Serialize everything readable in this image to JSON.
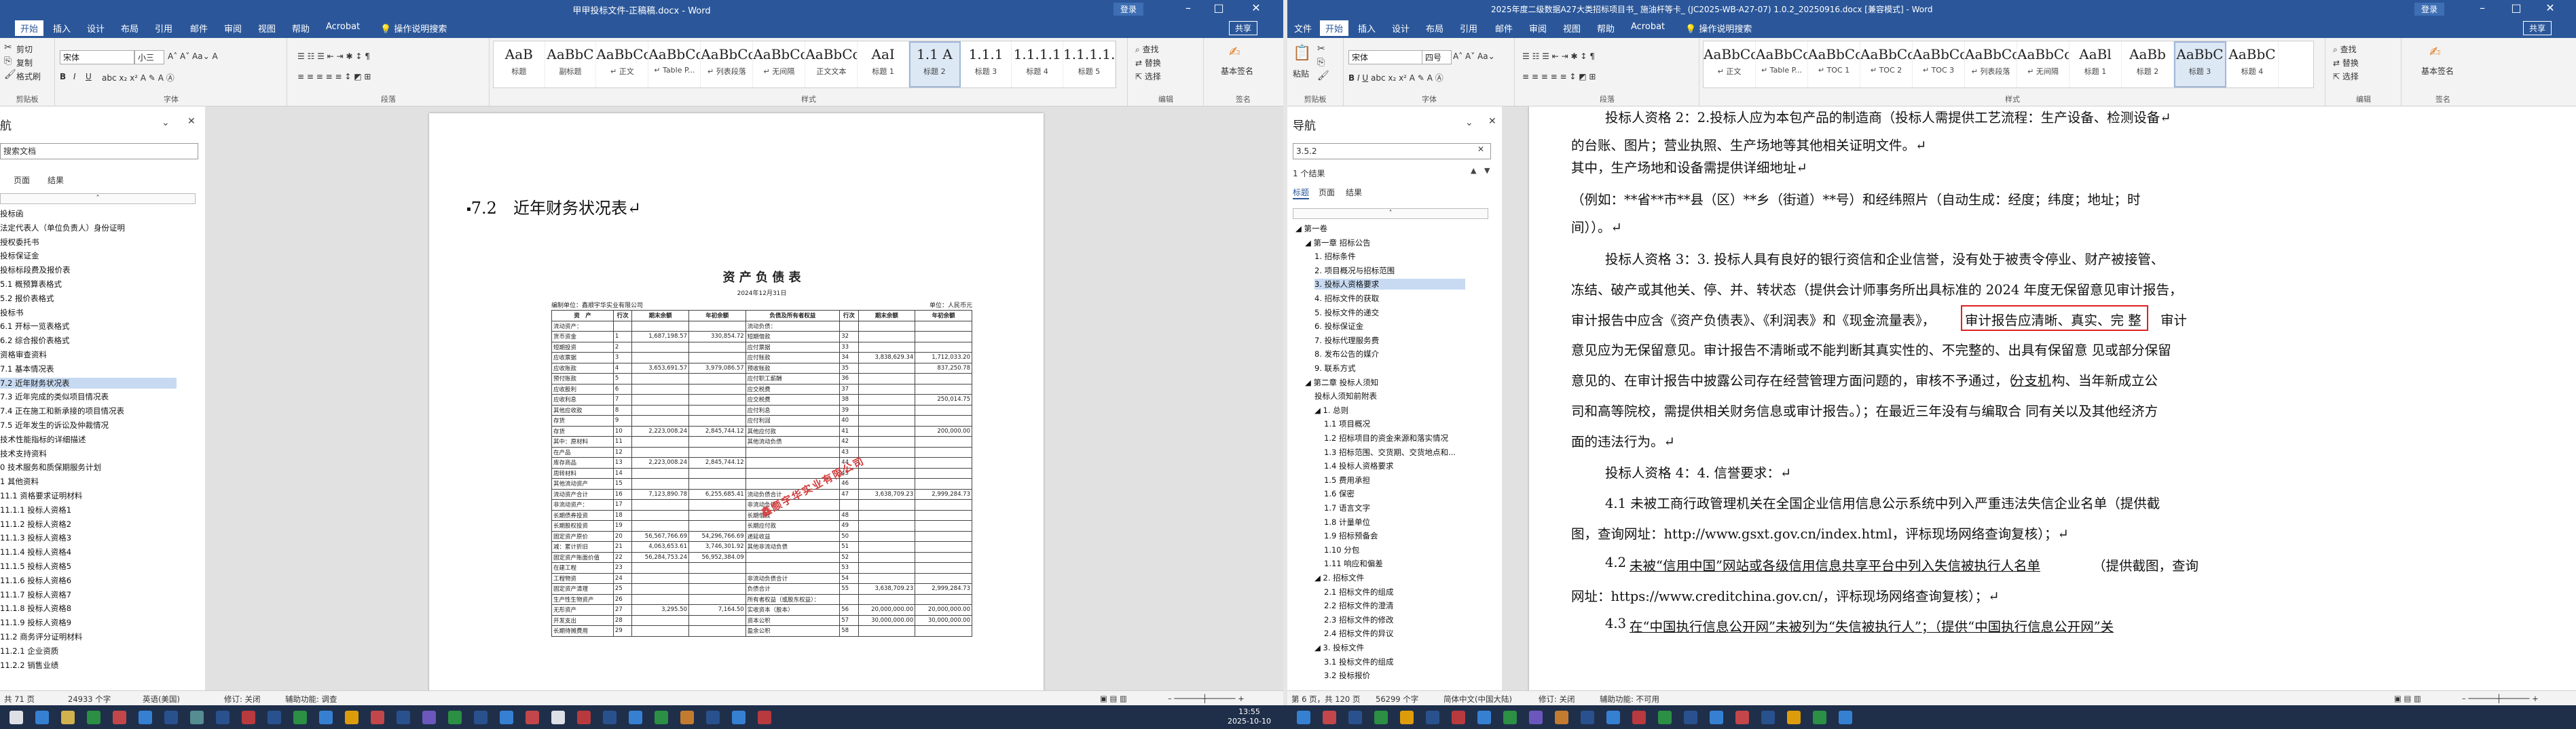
{
  "left_window": {
    "title": "甲甲投标文件-正稿稿.docx - Word",
    "login": "登录",
    "share": "共享",
    "tabs": [
      "开始",
      "插入",
      "设计",
      "布局",
      "引用",
      "邮件",
      "审阅",
      "视图",
      "帮助",
      "Acrobat",
      "操作说明搜索"
    ],
    "active_tab": "开始",
    "clipboard": {
      "paste": "粘贴",
      "cut": "剪切",
      "copy": "复制",
      "format_painter": "格式刷"
    },
    "font": {
      "name": "宋体",
      "size": "小三"
    },
    "group_labels": {
      "clipboard": "剪贴板",
      "font": "字体",
      "paragraph": "段落",
      "styles": "样式",
      "editing": "编辑",
      "sign": "签名"
    },
    "styles": [
      {
        "preview": "AaB",
        "label": "标题"
      },
      {
        "preview": "AaBbC",
        "label": "副标题"
      },
      {
        "preview": "AaBbCcDc",
        "label": "↵ 正文"
      },
      {
        "preview": "AaBbCcDc",
        "label": "↵ Table P..."
      },
      {
        "preview": "AaBbCcDc",
        "label": "↵ 列表段落"
      },
      {
        "preview": "AaBbCcDc",
        "label": "↵ 无间隔"
      },
      {
        "preview": "AaBbCcDdE",
        "label": "正文文本"
      },
      {
        "preview": "AaI",
        "label": "标题 1"
      },
      {
        "preview": "1.1 A",
        "label": "标题 2"
      },
      {
        "preview": "1.1.1",
        "label": "标题 3"
      },
      {
        "preview": "1.1.1.1",
        "label": "标题 4"
      },
      {
        "preview": "1.1.1.1.1",
        "label": "标题 5"
      }
    ],
    "editing": [
      "查找",
      "替换",
      "选择"
    ],
    "sign": "基本签名",
    "nav": {
      "title": "航",
      "search": "搜索文档",
      "subtabs": [
        "页面",
        "结果"
      ],
      "items": [
        {
          "text": "投标函",
          "sel": false
        },
        {
          "text": "法定代表人（单位负责人）身份证明",
          "sel": false
        },
        {
          "text": "授权委托书",
          "sel": false
        },
        {
          "text": "投标保证金",
          "sel": false
        },
        {
          "text": "投标标段费及报价表",
          "sel": false
        },
        {
          "text": "5.1 概预算表格式",
          "sel": false
        },
        {
          "text": "5.2 报价表格式",
          "sel": false
        },
        {
          "text": "投标书",
          "sel": false
        },
        {
          "text": "6.1 开标一览表格式",
          "sel": false
        },
        {
          "text": "6.2 综合报价表格式",
          "sel": false
        },
        {
          "text": "资格审查资料",
          "sel": false
        },
        {
          "text": "7.1 基本情况表",
          "sel": false
        },
        {
          "text": "7.2 近年财务状况表",
          "sel": true
        },
        {
          "text": "7.3 近年完成的类似项目情况表",
          "sel": false
        },
        {
          "text": "7.4 正在施工和新承接的项目情况表",
          "sel": false
        },
        {
          "text": "7.5 近年发生的诉讼及仲裁情况",
          "sel": false
        },
        {
          "text": "技术性能指标的详细描述",
          "sel": false
        },
        {
          "text": "技术支持资料",
          "sel": false
        },
        {
          "text": "0 技术服务和质保期服务计划",
          "sel": false
        },
        {
          "text": "1 其他资料",
          "sel": false
        },
        {
          "text": "11.1 资格要求证明材料",
          "sel": false
        },
        {
          "text": "11.1.1 投标人资格1",
          "sel": false
        },
        {
          "text": "11.1.2 投标人资格2",
          "sel": false
        },
        {
          "text": "11.1.3 投标人资格3",
          "sel": false
        },
        {
          "text": "11.1.4 投标人资格4",
          "sel": false
        },
        {
          "text": "11.1.5 投标人资格5",
          "sel": false
        },
        {
          "text": "11.1.6 投标人资格6",
          "sel": false
        },
        {
          "text": "11.1.7 投标人资格7",
          "sel": false
        },
        {
          "text": "11.1.8 投标人资格8",
          "sel": false
        },
        {
          "text": "11.1.9 投标人资格9",
          "sel": false
        },
        {
          "text": "11.2 商务评分证明材料",
          "sel": false
        },
        {
          "text": "11.2.1 企业资质",
          "sel": false
        },
        {
          "text": "11.2.2 销售业绩",
          "sel": false
        }
      ]
    },
    "heading": "7.2　近年财务状况表",
    "bs_title": "资 产 负 债 表",
    "bs_date": "2024年12月31日",
    "bs_company": "编制单位：鑫顺宇华实业有限公司",
    "bs_unit": "单位：人民币元",
    "bs_header": [
      "资　产",
      "行次",
      "期末余额",
      "年初余额",
      "负债及所有者权益",
      "行次",
      "期末余额",
      "年初余额"
    ],
    "bs_rows": [
      [
        "流动资产：",
        "",
        "",
        "",
        "流动负债：",
        "",
        "",
        ""
      ],
      [
        "货币资金",
        "1",
        "1,687,198.57",
        "330,854.72",
        "短期借款",
        "32",
        "",
        ""
      ],
      [
        "短期投资",
        "2",
        "",
        "",
        "应付票据",
        "33",
        "",
        ""
      ],
      [
        "应收票据",
        "3",
        "",
        "",
        "应付账款",
        "34",
        "3,838,629.34",
        "1,712,033.20"
      ],
      [
        "应收账款",
        "4",
        "3,653,691.57",
        "3,979,086.57",
        "预收账款",
        "35",
        "",
        "837,250.78"
      ],
      [
        "预付账款",
        "5",
        "",
        "",
        "应付职工薪酬",
        "36",
        "",
        ""
      ],
      [
        "应收股利",
        "6",
        "",
        "",
        "应交税费",
        "37",
        "",
        ""
      ],
      [
        "应收利息",
        "7",
        "",
        "",
        "应交税费",
        "38",
        "",
        "250,014.75"
      ],
      [
        "其他应收款",
        "8",
        "",
        "",
        "应付利息",
        "39",
        "",
        ""
      ],
      [
        "存货",
        "9",
        "",
        "",
        "应付利润",
        "40",
        "",
        ""
      ],
      [
        "存货",
        "10",
        "2,223,008.24",
        "2,845,744.12",
        "其他应付款",
        "41",
        "",
        "200,000.00"
      ],
      [
        "其中：原材料",
        "11",
        "",
        "",
        "其他流动负债",
        "42",
        "",
        ""
      ],
      [
        "在产品",
        "12",
        "",
        "",
        "",
        "43",
        "",
        ""
      ],
      [
        "库存商品",
        "13",
        "2,223,008.24",
        "2,845,744.12",
        "",
        "44",
        "",
        ""
      ],
      [
        "周转材料",
        "14",
        "",
        "",
        "",
        "45",
        "",
        ""
      ],
      [
        "其他流动资产",
        "15",
        "",
        "",
        "",
        "46",
        "",
        ""
      ],
      [
        "流动资产合计",
        "16",
        "7,123,890.78",
        "6,255,685.41",
        "流动负债合计",
        "47",
        "3,638,709.23",
        "2,999,284.73"
      ],
      [
        "非流动资产：",
        "17",
        "",
        "",
        "非流动负债：",
        "",
        "",
        ""
      ],
      [
        "长期债券投资",
        "18",
        "",
        "",
        "长期借款",
        "48",
        "",
        ""
      ],
      [
        "长期股权投资",
        "19",
        "",
        "",
        "长期应付款",
        "49",
        "",
        ""
      ],
      [
        "固定资产原价",
        "20",
        "56,567,766.69",
        "54,296,766.69",
        "递延收益",
        "50",
        "",
        ""
      ],
      [
        "减：累计折旧",
        "21",
        "4,063,653.61",
        "3,746,301.92",
        "其他非流动负债",
        "51",
        "",
        ""
      ],
      [
        "固定资产账面价值",
        "22",
        "56,284,753.24",
        "56,952,384.09",
        "",
        "52",
        "",
        ""
      ],
      [
        "在建工程",
        "23",
        "",
        "",
        "",
        "53",
        "",
        ""
      ],
      [
        "工程物资",
        "24",
        "",
        "",
        "非流动负债合计",
        "54",
        "",
        ""
      ],
      [
        "固定资产清理",
        "25",
        "",
        "",
        "负债合计",
        "55",
        "3,638,709.23",
        "2,999,284.73"
      ],
      [
        "生产性生物资产",
        "26",
        "",
        "",
        "所有者权益（或股东权益）：",
        "",
        "",
        ""
      ],
      [
        "无形资产",
        "27",
        "3,295.50",
        "7,164.50",
        "实收资本（股本）",
        "56",
        "20,000,000.00",
        "20,000,000.00"
      ],
      [
        "开发支出",
        "28",
        "",
        "",
        "资本公积",
        "57",
        "30,000,000.00",
        "30,000,000.00"
      ],
      [
        "长期待摊费用",
        "29",
        "",
        "",
        "盈余公积",
        "58",
        "",
        ""
      ]
    ],
    "stamp": "鑫顺宇华实业有限公司",
    "status": [
      "共 71 页",
      "24933 个字",
      "英语(美国)",
      "修订: 关闭",
      "辅助功能: 调查"
    ]
  },
  "right_window": {
    "title": "2025年度二级数据A27大类招标项目书_ 施油杆等卡_ (JC2025-WB-A27-07) 1.0.2_20250916.docx [兼容模式] - Word",
    "login": "登录",
    "share": "共享",
    "tabs": [
      "文件",
      "开始",
      "插入",
      "设计",
      "布局",
      "引用",
      "邮件",
      "审阅",
      "视图",
      "帮助",
      "Acrobat",
      "操作说明搜索"
    ],
    "active_tab": "开始",
    "clipboard": {
      "paste": "粘贴",
      "cut": "剪切",
      "copy": "复制",
      "format_painter": "格式刷"
    },
    "font": {
      "name": "宋体",
      "size": "四号"
    },
    "group_labels": {
      "clipboard": "剪贴板",
      "font": "字体",
      "paragraph": "段落",
      "styles": "样式",
      "editing": "编辑",
      "sign": "签名"
    },
    "styles": [
      {
        "preview": "AaBbCcDd",
        "label": "↵ 正文"
      },
      {
        "preview": "AaBbCcDd",
        "label": "↵ Table P..."
      },
      {
        "preview": "AaBbCc",
        "label": "↵ TOC 1"
      },
      {
        "preview": "AaBbCcDd",
        "label": "↵ TOC 2"
      },
      {
        "preview": "AaBbCcDd",
        "label": "↵ TOC 3"
      },
      {
        "preview": "AaBbCcDd",
        "label": "↵ 列表段落"
      },
      {
        "preview": "AaBbCcDd",
        "label": "↵ 无间隔"
      },
      {
        "preview": "AaBl",
        "label": "标题 1"
      },
      {
        "preview": "AaBb",
        "label": "标题 2"
      },
      {
        "preview": "AaBbC",
        "label": "标题 3"
      },
      {
        "preview": "AaBbC",
        "label": "标题 4"
      }
    ],
    "editing": [
      "查找",
      "替换",
      "选择"
    ],
    "sign": "基本签名",
    "nav": {
      "title": "导航",
      "search": "3.5.2",
      "result_count": "1 个结果",
      "subtabs": [
        "标题",
        "页面",
        "结果"
      ],
      "items": [
        {
          "text": "◢ 第一卷",
          "indent": 0,
          "sel": false
        },
        {
          "text": "◢ 第一章 招标公告",
          "indent": 1,
          "sel": false
        },
        {
          "text": "1. 招标条件",
          "indent": 2,
          "sel": false
        },
        {
          "text": "2. 项目概况与招标范围",
          "indent": 2,
          "sel": false
        },
        {
          "text": "3. 投标人资格要求",
          "indent": 2,
          "sel": true
        },
        {
          "text": "4. 招标文件的获取",
          "indent": 2,
          "sel": false
        },
        {
          "text": "5. 投标文件的递交",
          "indent": 2,
          "sel": false
        },
        {
          "text": "6. 投标保证金",
          "indent": 2,
          "sel": false
        },
        {
          "text": "7. 投标代理服务费",
          "indent": 2,
          "sel": false
        },
        {
          "text": "8. 发布公告的媒介",
          "indent": 2,
          "sel": false
        },
        {
          "text": "9. 联系方式",
          "indent": 2,
          "sel": false
        },
        {
          "text": "◢ 第二章 投标人须知",
          "indent": 1,
          "sel": false
        },
        {
          "text": "投标人须知前附表",
          "indent": 2,
          "sel": false
        },
        {
          "text": "◢ 1. 总则",
          "indent": 2,
          "sel": false
        },
        {
          "text": "1.1 项目概况",
          "indent": 3,
          "sel": false
        },
        {
          "text": "1.2 招标项目的资金来源和落实情况",
          "indent": 3,
          "sel": false
        },
        {
          "text": "1.3 招标范围、交货期、交货地点和...",
          "indent": 3,
          "sel": false
        },
        {
          "text": "1.4 投标人资格要求",
          "indent": 3,
          "sel": false
        },
        {
          "text": "1.5 费用承担",
          "indent": 3,
          "sel": false
        },
        {
          "text": "1.6 保密",
          "indent": 3,
          "sel": false
        },
        {
          "text": "1.7 语言文字",
          "indent": 3,
          "sel": false
        },
        {
          "text": "1.8 计量单位",
          "indent": 3,
          "sel": false
        },
        {
          "text": "1.9 招标预备会",
          "indent": 3,
          "sel": false
        },
        {
          "text": "1.10 分包",
          "indent": 3,
          "sel": false
        },
        {
          "text": "1.11 响应和偏差",
          "indent": 3,
          "sel": false
        },
        {
          "text": "◢ 2. 招标文件",
          "indent": 2,
          "sel": false
        },
        {
          "text": "2.1 招标文件的组成",
          "indent": 3,
          "sel": false
        },
        {
          "text": "2.2 招标文件的澄清",
          "indent": 3,
          "sel": false
        },
        {
          "text": "2.3 招标文件的修改",
          "indent": 3,
          "sel": false
        },
        {
          "text": "2.4 招标文件的异议",
          "indent": 3,
          "sel": false
        },
        {
          "text": "◢ 3. 投标文件",
          "indent": 2,
          "sel": false
        },
        {
          "text": "3.1 投标文件的组成",
          "indent": 3,
          "sel": false
        },
        {
          "text": "3.2 投标报价",
          "indent": 3,
          "sel": false
        }
      ]
    },
    "lines": [
      "投标人资格 2：2.投标人应为本包产品的制造商（投标人需提供工艺流程：生产设备、检测设备↵",
      "的台账、图片；营业执照、生产场地等其他相关证明文件。↵",
      "其中，生产场地和设备需提供详细地址↵",
      "（例如：**省**市**县（区）**乡（街道）**号）和经纬照片（自动生成：经度；纬度；地址；时",
      "间））。↵",
      "投标人资格 3：3. 投标人具有良好的银行资信和企业信誉，没有处于被责令停业、财产被接管、",
      "冻结、破产或其他关、停、并、转状态（提供会计师事务所出具标准的 2024 年度无保留意见审计报告，",
      "审计报告中应含《资产负债表》、《利润表》和《现金流量表》，",
      "审计报告应清晰、真实、完 整",
      "审计",
      "意见应为无保留意见。审计报告不清晰或不能判断其真实性的、不完整的、出具有保留意 见或部分保留",
      "意见的、在审计报告中披露公司存在经营管理方面问题的，审核不予通过，（",
      "分支机",
      "构、当年新成立公",
      "司和高等院校，需提供相关财务信息或审计报告。）；在最近三年没有与编取合 同有关以及其他经济方",
      "面的违法行为。↵",
      "投标人资格 4：4. 信誉要求：↵",
      "4.1 未被工商行政管理机关在全国企业信用信息公示系统中列入严重违法失信企业名单（提供截",
      "图，查询网址：http://www.gsxt.gov.cn/index.html，评标现场网络查询复核）；↵",
      "4.2 ",
      "未被“信用中国”网站或各级信用信息共享平台中列入失信被执行人名单",
      "（提供截图，查询",
      "网址：https://www.creditchina.gov.cn/，评标现场网络查询复核）；↵",
      "4.3 ",
      "在“中国执行信息公开网”未被列为“失信被执行人”；（提供“中国执行信息公开网”关"
    ],
    "status": [
      "第 6 页，共 120 页",
      "56299 个字",
      "简体中文(中国大陆)",
      "修订: 关闭",
      "辅助功能: 不可用"
    ]
  },
  "taskbar": {
    "time": "13:55",
    "date": "2025-10-10"
  }
}
